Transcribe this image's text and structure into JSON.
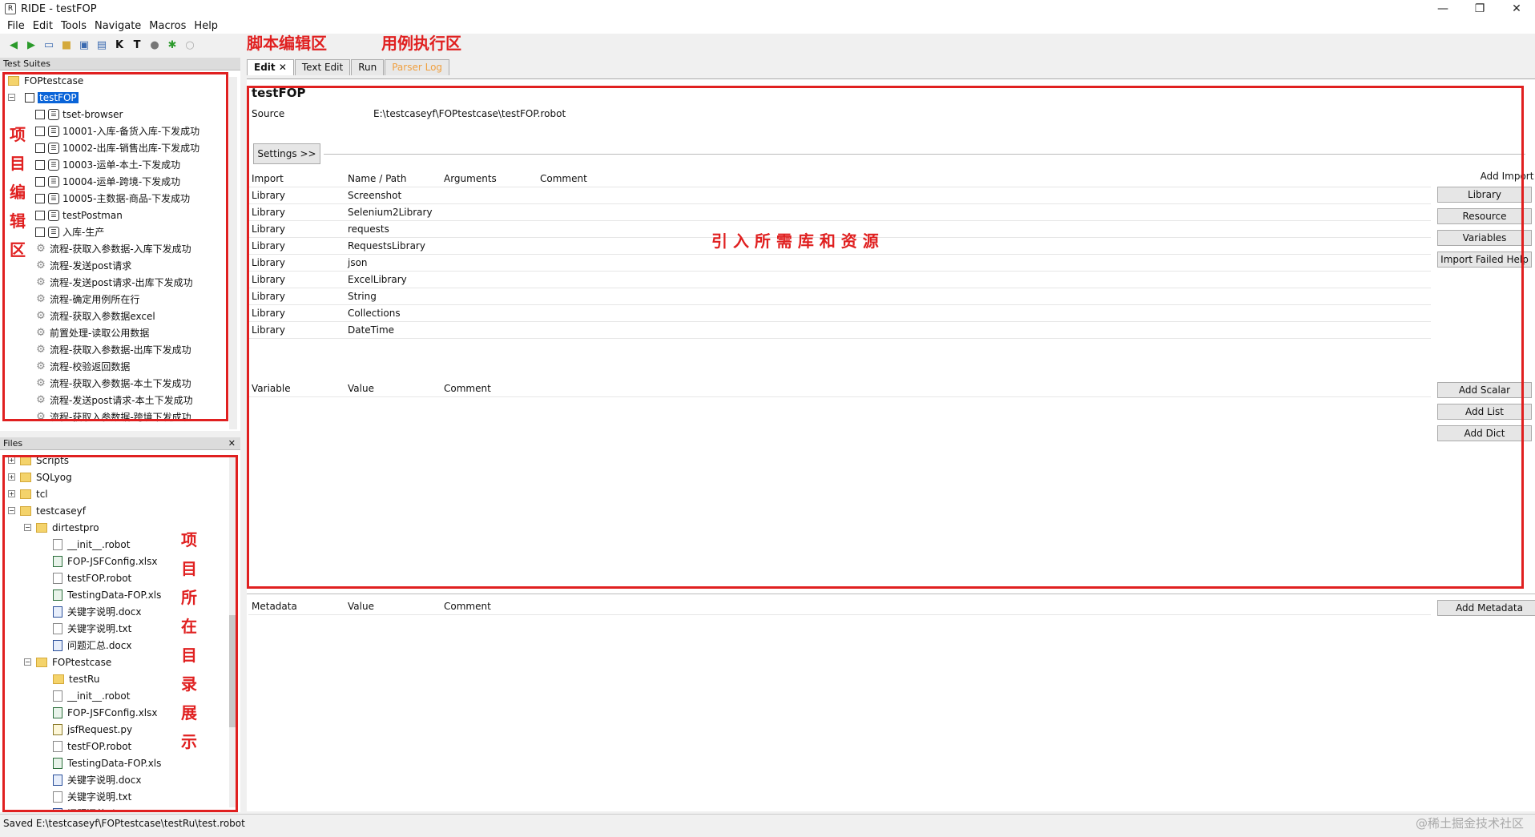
{
  "window": {
    "title": "RIDE - testFOP",
    "minimize": "—",
    "restore": "❐",
    "close": "✕"
  },
  "menu": [
    "File",
    "Edit",
    "Tools",
    "Navigate",
    "Macros",
    "Help"
  ],
  "annotations": {
    "script_edit": "脚本编辑区",
    "case_run": "用例执行区",
    "project_edit_chars": [
      "项",
      "目",
      "编",
      "辑",
      "区"
    ],
    "import_libs": "引 入 所 需 库 和 资 源",
    "project_dir_chars": [
      "项",
      "目",
      "所",
      "在",
      "目",
      "录",
      "展",
      "示"
    ]
  },
  "test_suites": {
    "title": "Test Suites",
    "root": "FOPtestcase",
    "suite": "testFOP",
    "cases": [
      "tset-browser",
      "10001-入库-备货入库-下发成功",
      "10002-出库-销售出库-下发成功",
      "10003-运单-本土-下发成功",
      "10004-运单-跨境-下发成功",
      "10005-主数据-商品-下发成功",
      "testPostman",
      "入库-生产"
    ],
    "keywords": [
      "流程-获取入参数据-入库下发成功",
      "流程-发送post请求",
      "流程-发送post请求-出库下发成功",
      "流程-确定用例所在行",
      "流程-获取入参数据excel",
      "前置处理-读取公用数据",
      "流程-获取入参数据-出库下发成功",
      "流程-校验返回数据",
      "流程-获取入参数据-本土下发成功",
      "流程-发送post请求-本土下发成功",
      "流程-获取入参数据-跨境下发成功"
    ]
  },
  "files": {
    "title": "Files",
    "top": [
      "Scripts",
      "SQLyog",
      "tcl",
      "testcaseyf"
    ],
    "dirtestpro": {
      "name": "dirtestpro",
      "items": [
        {
          "name": "__init__.robot",
          "kind": "file"
        },
        {
          "name": "FOP-JSFConfig.xlsx",
          "kind": "xls"
        },
        {
          "name": "testFOP.robot",
          "kind": "file"
        },
        {
          "name": "TestingData-FOP.xls",
          "kind": "xls"
        },
        {
          "name": "关键字说明.docx",
          "kind": "doc"
        },
        {
          "name": "关键字说明.txt",
          "kind": "file"
        },
        {
          "name": "问题汇总.docx",
          "kind": "doc"
        }
      ]
    },
    "foptestcase": {
      "name": "FOPtestcase",
      "items": [
        {
          "name": "testRu",
          "kind": "folder"
        },
        {
          "name": "__init__.robot",
          "kind": "file"
        },
        {
          "name": "FOP-JSFConfig.xlsx",
          "kind": "xls"
        },
        {
          "name": "jsfRequest.py",
          "kind": "py"
        },
        {
          "name": "testFOP.robot",
          "kind": "file"
        },
        {
          "name": "TestingData-FOP.xls",
          "kind": "xls"
        },
        {
          "name": "关键字说明.docx",
          "kind": "doc"
        },
        {
          "name": "关键字说明.txt",
          "kind": "file"
        },
        {
          "name": "问题汇总.docx",
          "kind": "doc"
        }
      ]
    }
  },
  "tabs": [
    "Edit",
    "Text Edit",
    "Run",
    "Parser Log"
  ],
  "editor": {
    "heading": "testFOP",
    "source_label": "Source",
    "source_value": "E:\\testcaseyf\\FOPtestcase\\testFOP.robot",
    "settings_btn": "Settings >>",
    "import_headers": [
      "Import",
      "Name / Path",
      "Arguments",
      "Comment"
    ],
    "imports": [
      [
        "Library",
        "Screenshot"
      ],
      [
        "Library",
        "Selenium2Library"
      ],
      [
        "Library",
        "requests"
      ],
      [
        "Library",
        "RequestsLibrary"
      ],
      [
        "Library",
        "json"
      ],
      [
        "Library",
        "ExcelLibrary"
      ],
      [
        "Library",
        "String"
      ],
      [
        "Library",
        "Collections"
      ],
      [
        "Library",
        "DateTime"
      ]
    ],
    "add_import": "Add Import",
    "import_buttons": [
      "Library",
      "Resource",
      "Variables",
      "Import Failed Help"
    ],
    "variable_headers": [
      "Variable",
      "Value",
      "Comment"
    ],
    "variable_buttons": [
      "Add Scalar",
      "Add List",
      "Add Dict"
    ],
    "metadata_headers": [
      "Metadata",
      "Value",
      "Comment"
    ],
    "metadata_button": "Add Metadata"
  },
  "status": "Saved E:\\testcaseyf\\FOPtestcase\\testRu\\test.robot",
  "watermark": "@稀土掘金技术社区"
}
